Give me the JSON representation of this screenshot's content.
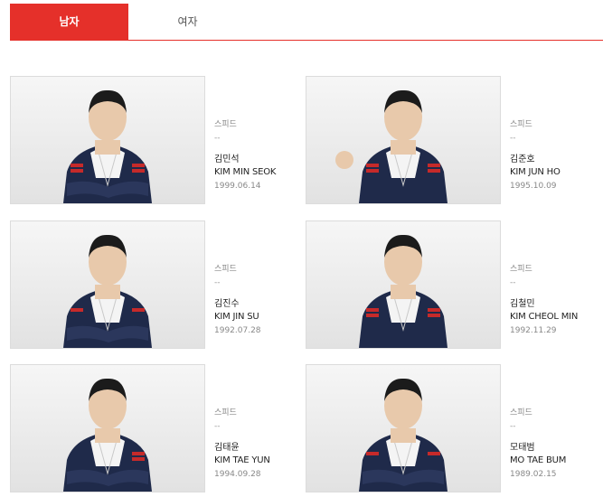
{
  "tabs": [
    {
      "label": "남자",
      "active": true
    },
    {
      "label": "여자",
      "active": false
    }
  ],
  "accent_color": "#e5302a",
  "athletes": [
    {
      "category": "스피드",
      "dash": "--",
      "name_ko": "김민석",
      "name_en": "KIM MIN SEOK",
      "birth": "1999.06.14"
    },
    {
      "category": "스피드",
      "dash": "--",
      "name_ko": "김준호",
      "name_en": "KIM JUN HO",
      "birth": "1995.10.09"
    },
    {
      "category": "스피드",
      "dash": "--",
      "name_ko": "김진수",
      "name_en": "KIM JIN SU",
      "birth": "1992.07.28"
    },
    {
      "category": "스피드",
      "dash": "--",
      "name_ko": "김철민",
      "name_en": "KIM CHEOL MIN",
      "birth": "1992.11.29"
    },
    {
      "category": "스피드",
      "dash": "--",
      "name_ko": "김태윤",
      "name_en": "KIM TAE YUN",
      "birth": "1994.09.28"
    },
    {
      "category": "스피드",
      "dash": "--",
      "name_ko": "모태범",
      "name_en": "MO TAE BUM",
      "birth": "1989.02.15"
    }
  ]
}
